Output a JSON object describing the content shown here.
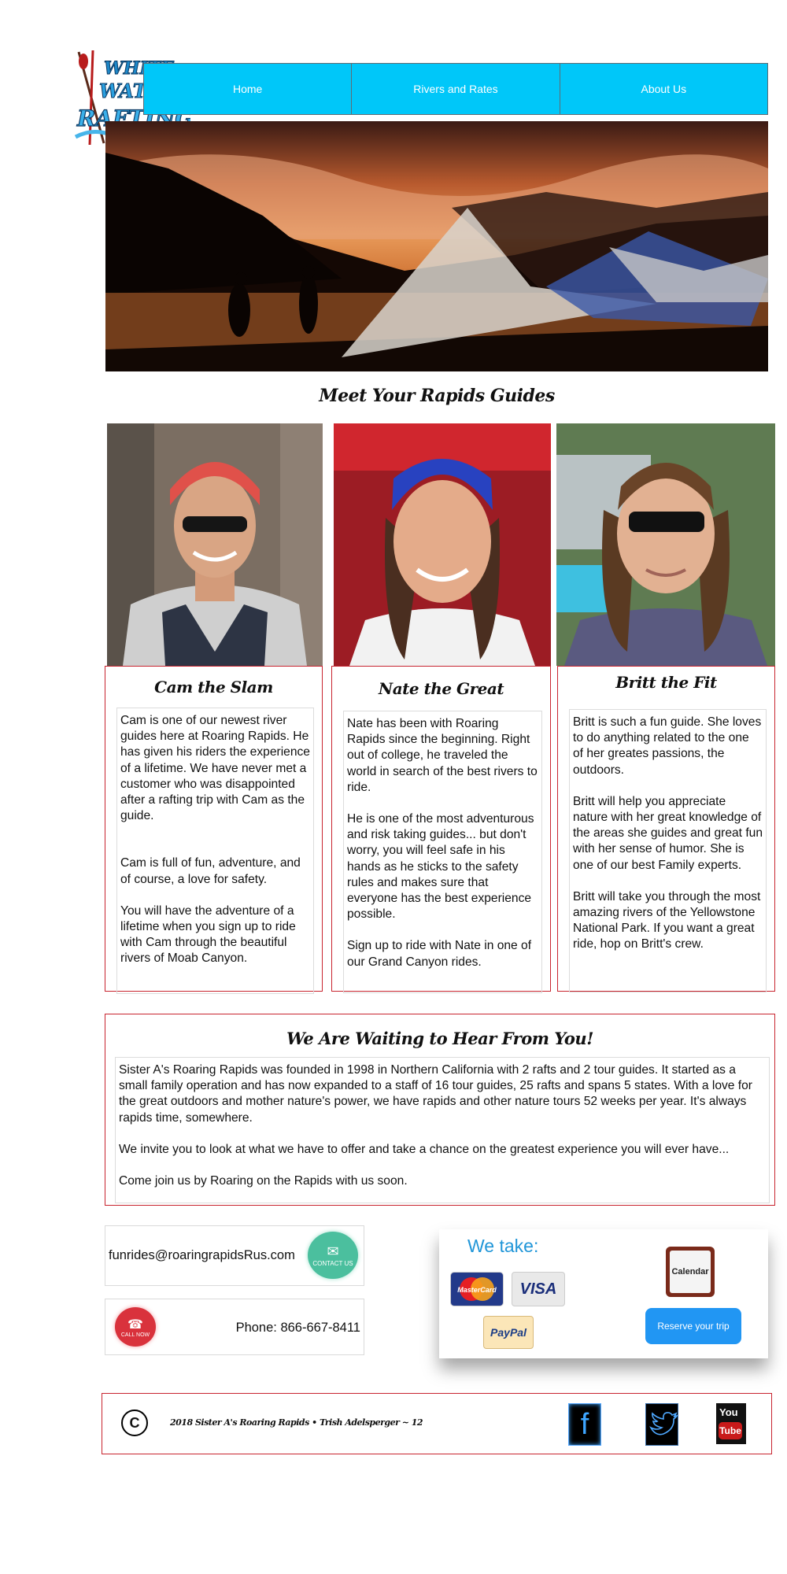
{
  "logo": {
    "line1": "WHITE",
    "line2": "WATER",
    "line3": "RAFTING"
  },
  "nav": {
    "items": [
      {
        "label": "Home"
      },
      {
        "label": "Rivers and Rates"
      },
      {
        "label": "About Us"
      }
    ]
  },
  "guides_section": {
    "title": "Meet Your Rapids Guides"
  },
  "guides": [
    {
      "name": "Cam the Slam",
      "paragraphs": [
        "Cam is one of our newest river guides here at Roaring Rapids.  He has given his riders the experience of a lifetime.  We have never met a customer who was disappointed after a rafting trip with Cam as the guide.",
        "Cam is full of fun, adventure, and of course, a love for safety.",
        "You will have the adventure of a lifetime when you sign up to ride with Cam through the beautiful rivers of Moab Canyon."
      ]
    },
    {
      "name": "Nate the Great",
      "paragraphs": [
        "Nate has been with Roaring Rapids since the beginning.  Right out of college, he traveled the world in search of the best rivers to ride.",
        "He is one of the most adventurous and risk taking guides... but don't worry, you will feel safe in his hands as he sticks to the safety rules and makes sure that everyone has the best experience possible.",
        "Sign up to ride with Nate in one of our Grand Canyon rides."
      ]
    },
    {
      "name": "Britt the Fit",
      "paragraphs": [
        "Britt is such a fun guide.  She loves to do anything related to the one of her greates passions, the outdoors.",
        "Britt will help you appreciate nature with her great knowledge of the areas she guides and great fun with her sense of humor.  She is one of our best Family experts.",
        "Britt will take you through the most amazing rivers of the Yellowstone National Park.  If you want a great ride, hop on Britt's crew."
      ]
    }
  ],
  "waiting": {
    "title": "We Are Waiting to Hear From You!",
    "paragraphs": [
      "Sister A's Roaring Rapids was founded in 1998 in Northern California with 2 rafts and 2 tour guides.  It started as a small family operation and has now expanded to a staff of 16 tour guides, 25 rafts and spans 5 states.  With a love for the great outdoors and mother nature's power, we have rapids and other nature tours 52 weeks per year.  It's always rapids time, somewhere.",
      "We invite you to look at what we have to offer and take a chance on the greatest experience you will ever have...",
      "Come join us by Roaring on the Rapids with us soon."
    ]
  },
  "contact": {
    "email": "funrides@roaringrapidsRus.com",
    "email_icon_label": "CONTACT US",
    "phone": "Phone:  866-667-8411",
    "call_icon_label": "CALL NOW"
  },
  "payment": {
    "heading": "We take:",
    "mastercard": "MasterCard",
    "visa": "VISA",
    "paypal": "PayPal",
    "calendar": "Calendar",
    "reserve_button": "Reserve your trip"
  },
  "footer": {
    "copyright_symbol": "C",
    "text": "2018 Sister A's Roaring Rapids • Trish Adelsperger ~ 12",
    "social": [
      "facebook-icon",
      "twitter-icon",
      "youtube-icon"
    ],
    "youtube_top": "You",
    "youtube_bottom": "Tube"
  },
  "colors": {
    "nav": "#00c7f9",
    "border_red": "#c8242f",
    "accent_blue": "#2196f3"
  }
}
